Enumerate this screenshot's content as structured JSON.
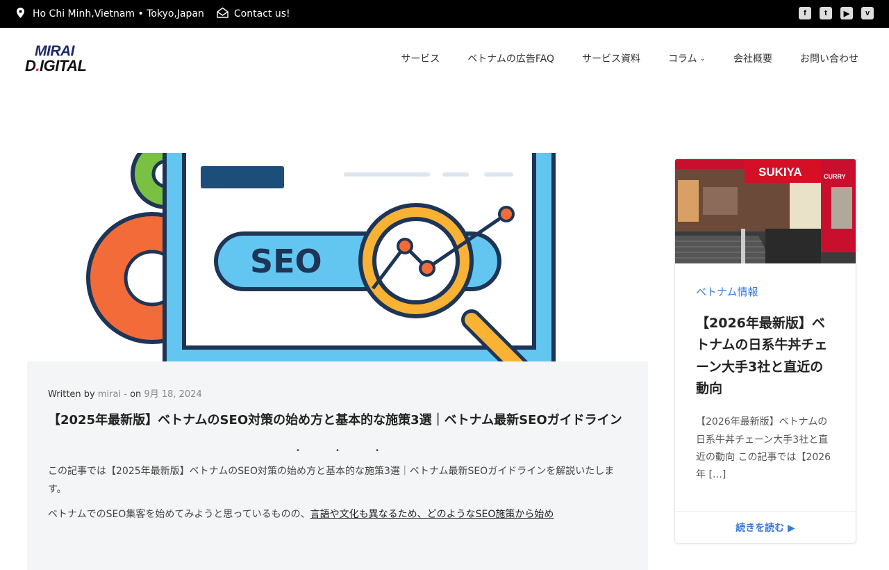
{
  "topbar": {
    "location": "Ho Chi Minh,Vietnam • Tokyo,Japan",
    "contact": "Contact us!",
    "socials": [
      "facebook-icon",
      "twitter-icon",
      "youtube-icon",
      "vimeo-icon"
    ]
  },
  "logo": {
    "line1": "MIRAI",
    "line2_a": "D",
    "line2_dot": ".",
    "line2_b": "IGITAL"
  },
  "nav": {
    "items": [
      "サービス",
      "ベトナムの広告FAQ",
      "サービス資料",
      "コラム",
      "会社概要",
      "お問い合わせ"
    ]
  },
  "hero": {
    "label": "SEO"
  },
  "post": {
    "written_by": "Written by",
    "author": "mirai",
    "sep": "-",
    "on": "on",
    "date": "9月 18, 2024",
    "title": "【2025年最新版】ベトナムのSEO対策の始め方と基本的な施策3選｜ベトナム最新SEOガイドライン",
    "dots": "• • •",
    "excerpt": "この記事では【2025年最新版】ベトナムのSEO対策の始め方と基本的な施策3選｜ベトナム最新SEOガイドラインを解説いたします。",
    "excerpt2_plain": "ベトナムでのSEO集客を始めてみようと思っているものの、",
    "excerpt2_link": "言語や文化も異なるため、どのようなSEO施策から始め"
  },
  "sidebar": {
    "image_sign": "SUKIYA",
    "image_sign2": "CURRY",
    "category": "ベトナム情報",
    "title": "【2026年最新版】ベトナムの日系牛丼チェーン大手3社と直近の動向",
    "excerpt": "【2026年最新版】ベトナムの日系牛丼チェーン大手3社と直近の動向 この記事では【2026年 […]",
    "more": "続きを読む ▶"
  },
  "colors": {
    "accent": "#3a7bd5",
    "topbar": "#000000",
    "card_bg": "#f4f5f6"
  }
}
